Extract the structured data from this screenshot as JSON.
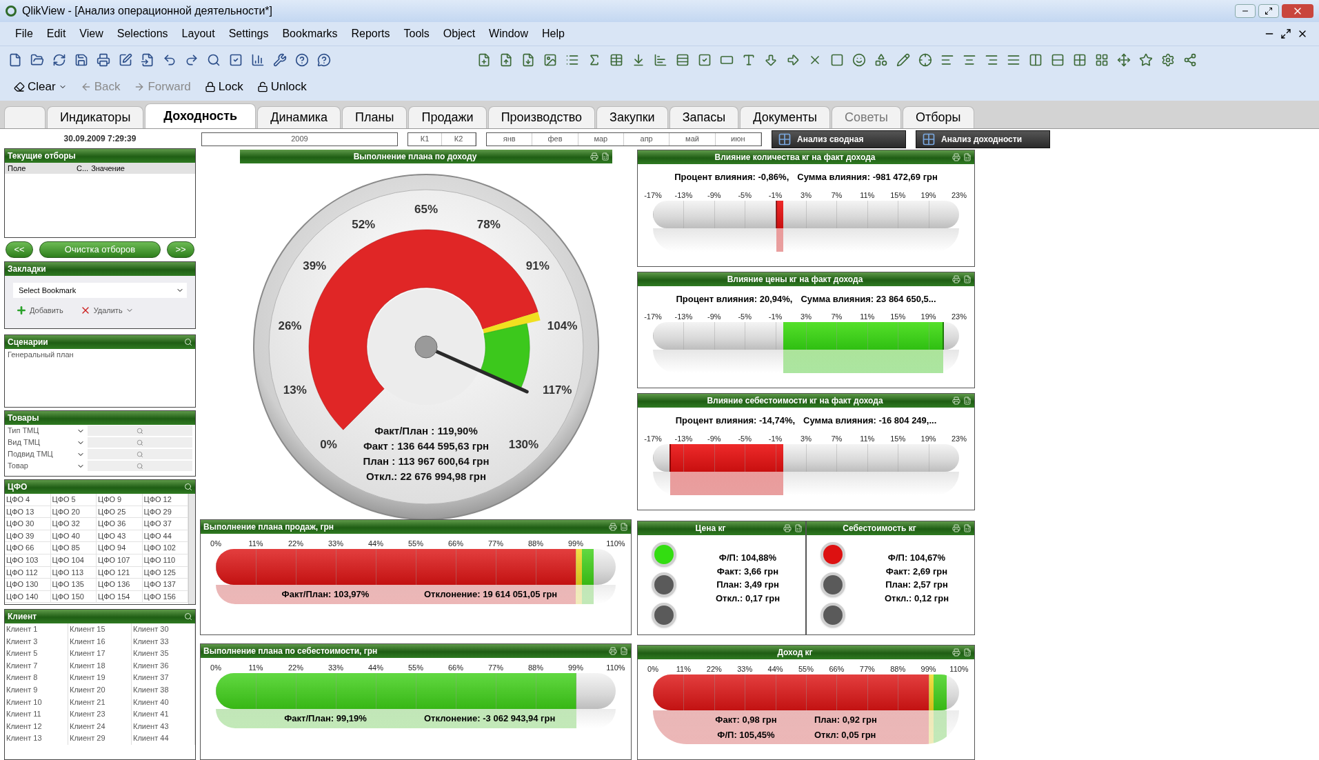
{
  "window": {
    "title": "QlikView - [Анализ операционной деятельности*]"
  },
  "menu": [
    "File",
    "Edit",
    "View",
    "Selections",
    "Layout",
    "Settings",
    "Bookmarks",
    "Reports",
    "Tools",
    "Object",
    "Window",
    "Help"
  ],
  "nav_toolbar": [
    {
      "label": "Clear",
      "kind": "clear",
      "disabled": false
    },
    {
      "label": "Back",
      "kind": "back",
      "disabled": true
    },
    {
      "label": "Forward",
      "kind": "forward",
      "disabled": true
    },
    {
      "label": "Lock",
      "kind": "lock",
      "disabled": false
    },
    {
      "label": "Unlock",
      "kind": "unlock",
      "disabled": false
    }
  ],
  "tabs": [
    {
      "label": "Индикаторы",
      "selected": false,
      "disabled": false
    },
    {
      "label": "Доходность",
      "selected": true,
      "disabled": false
    },
    {
      "label": "Динамика",
      "selected": false,
      "disabled": false
    },
    {
      "label": "Планы",
      "selected": false,
      "disabled": false
    },
    {
      "label": "Продажи",
      "selected": false,
      "disabled": false
    },
    {
      "label": "Производство",
      "selected": false,
      "disabled": false
    },
    {
      "label": "Закупки",
      "selected": false,
      "disabled": false
    },
    {
      "label": "Запасы",
      "selected": false,
      "disabled": false
    },
    {
      "label": "Документы",
      "selected": false,
      "disabled": false
    },
    {
      "label": "Советы",
      "selected": false,
      "disabled": true
    },
    {
      "label": "Отборы",
      "selected": false,
      "disabled": false
    }
  ],
  "timestamp": "30.09.2009 7:29:39",
  "period_filter": {
    "years": [
      "2009"
    ],
    "quarters": [
      "К1",
      "К2"
    ],
    "months": [
      "янв",
      "фев",
      "мар",
      "апр",
      "май",
      "июн"
    ]
  },
  "analysis_buttons": [
    "Анализ сводная",
    "Анализ доходности"
  ],
  "sidebar": {
    "current_selections": {
      "title": "Текущие отборы",
      "columns": [
        "Поле",
        "С...",
        "Значение"
      ]
    },
    "nav_buttons": [
      "<<",
      "Очистка отборов",
      ">>"
    ],
    "bookmarks": {
      "title": "Закладки",
      "value": "Select Bookmark",
      "actions": [
        {
          "label": "Добавить",
          "kind": "add"
        },
        {
          "label": "Удалить",
          "kind": "remove"
        }
      ]
    },
    "scenarios": {
      "title": "Сценарии",
      "items": [
        "Генеральный план"
      ]
    },
    "goods": {
      "title": "Товары",
      "fields": [
        "Тип ТМЦ",
        "Вид ТМЦ",
        "Подвид ТМЦ",
        "Товар"
      ]
    },
    "cfo": {
      "title": "ЦФО",
      "items": [
        "ЦФО 4",
        "ЦФО 5",
        "ЦФО 9",
        "ЦФО 12",
        "ЦФО 13",
        "ЦФО 20",
        "ЦФО 25",
        "ЦФО 29",
        "ЦФО 30",
        "ЦФО 32",
        "ЦФО 36",
        "ЦФО 37",
        "ЦФО 39",
        "ЦФО 40",
        "ЦФО 43",
        "ЦФО 44",
        "ЦФО 66",
        "ЦФО 85",
        "ЦФО 94",
        "ЦФО 102",
        "ЦФО 103",
        "ЦФО 104",
        "ЦФО 107",
        "ЦФО 110",
        "ЦФО 112",
        "ЦФО 113",
        "ЦФО 121",
        "ЦФО 125",
        "ЦФО 130",
        "ЦФО 135",
        "ЦФО 136",
        "ЦФО 137",
        "ЦФО 140",
        "ЦФО 150",
        "ЦФО 154",
        "ЦФО 156"
      ]
    },
    "clients": {
      "title": "Клиент",
      "columns": [
        [
          "Клиент 1",
          "Клиент 3",
          "Клиент 5",
          "Клиент 7",
          "Клиент 8",
          "Клиент 9",
          "Клиент 10",
          "Клиент 11",
          "Клиент 12",
          "Клиент 13"
        ],
        [
          "Клиент 15",
          "Клиент 16",
          "Клиент 17",
          "Клиент 18",
          "Клиент 19",
          "Клиент 20",
          "Клиент 21",
          "Клиент 23",
          "Клиент 24",
          "Клиент 29"
        ],
        [
          "Клиент 30",
          "Клиент 33",
          "Клиент 35",
          "Клиент 36",
          "Клиент 37",
          "Клиент 38",
          "Клиент 40",
          "Клиент 41",
          "Клиент 43",
          "Клиент 44"
        ]
      ]
    }
  },
  "revenue_gauge": {
    "title": "Выполнение плана по доходу",
    "scale": [
      "0%",
      "13%",
      "26%",
      "39%",
      "52%",
      "65%",
      "78%",
      "91%",
      "104%",
      "117%",
      "130%"
    ],
    "level": 0.922,
    "readouts": [
      "Факт/План : 119,90%",
      "Факт : 136 644 595,63 грн",
      "План : 113 967 600,64 грн",
      "Откл.: 22 676 994,98 грн"
    ]
  },
  "impact_panels": [
    {
      "title": "Влияние количества кг на факт дохода",
      "percent": "Процент влияния: -0,86%,",
      "sum": "Сумма влияния: -981 472,69 грн",
      "scale": [
        "-17%",
        "-13%",
        "-9%",
        "-5%",
        "-1%",
        "3%",
        "7%",
        "11%",
        "15%",
        "19%",
        "23%"
      ],
      "level": 0.4035
    },
    {
      "title": "Влияние цены кг на факт дохода",
      "percent": "Процент влияния: 20,94%,",
      "sum": "Сумма влияния: 23 864 650,5...",
      "scale": [
        "-17%",
        "-13%",
        "-9%",
        "-5%",
        "-1%",
        "3%",
        "7%",
        "11%",
        "15%",
        "19%",
        "23%"
      ],
      "level": 0.9485
    },
    {
      "title": "Влияние себестоимости кг на факт дохода",
      "percent": "Процент влияния: -14,74%,",
      "sum": "Сумма влияния: -16 804 249,...",
      "scale": [
        "-17%",
        "-13%",
        "-9%",
        "-5%",
        "-1%",
        "3%",
        "7%",
        "11%",
        "15%",
        "19%",
        "23%"
      ],
      "level": 0.0565
    }
  ],
  "plan_bars": [
    {
      "title": "Выполнение плана продаж, грн",
      "kind": "revenue",
      "scale": [
        "0%",
        "11%",
        "22%",
        "33%",
        "44%",
        "55%",
        "66%",
        "77%",
        "88%",
        "99%",
        "110%"
      ],
      "level": 0.945,
      "notes": [
        "Факт/План: 103,97%",
        "Отклонение: 19 614 051,05 грн"
      ]
    },
    {
      "title": "Выполнение плана по себестоимости, грн",
      "kind": "cost",
      "scale": [
        "0%",
        "11%",
        "22%",
        "33%",
        "44%",
        "55%",
        "66%",
        "77%",
        "88%",
        "99%",
        "110%"
      ],
      "level": 0.902,
      "notes": [
        "Факт/План: 99,19%",
        "Отклонение: -3 062 943,94 грн"
      ]
    }
  ],
  "unit_indicators": [
    {
      "title": "Цена кг",
      "color": "#33dd11",
      "lamps": [
        {
          "on": true
        },
        {
          "on": false
        },
        {
          "on": false
        }
      ],
      "lines": [
        "Ф/П: 104,88%",
        "Факт: 3,66 грн",
        "План: 3,49 грн",
        "Откл.: 0,17 грн"
      ]
    },
    {
      "title": "Себестоимость кг",
      "color": "#dd1111",
      "lamps": [
        {
          "on": true
        },
        {
          "on": false
        },
        {
          "on": false
        }
      ],
      "lines": [
        "Ф/П: 104,67%",
        "Факт: 2,69 грн",
        "План: 2,57 грн",
        "Откл.: 0,12 грн"
      ]
    }
  ],
  "unit_revenue": {
    "title": "Доход кг",
    "kind": "revenue",
    "scale": [
      "0%",
      "11%",
      "22%",
      "33%",
      "44%",
      "55%",
      "66%",
      "77%",
      "88%",
      "99%",
      "110%"
    ],
    "level": 0.9586,
    "notes": [
      "Факт: 0,98 грн",
      "План: 0,92 грн",
      "Ф/П: 105,45%",
      "Откл: 0,05 грн"
    ]
  }
}
